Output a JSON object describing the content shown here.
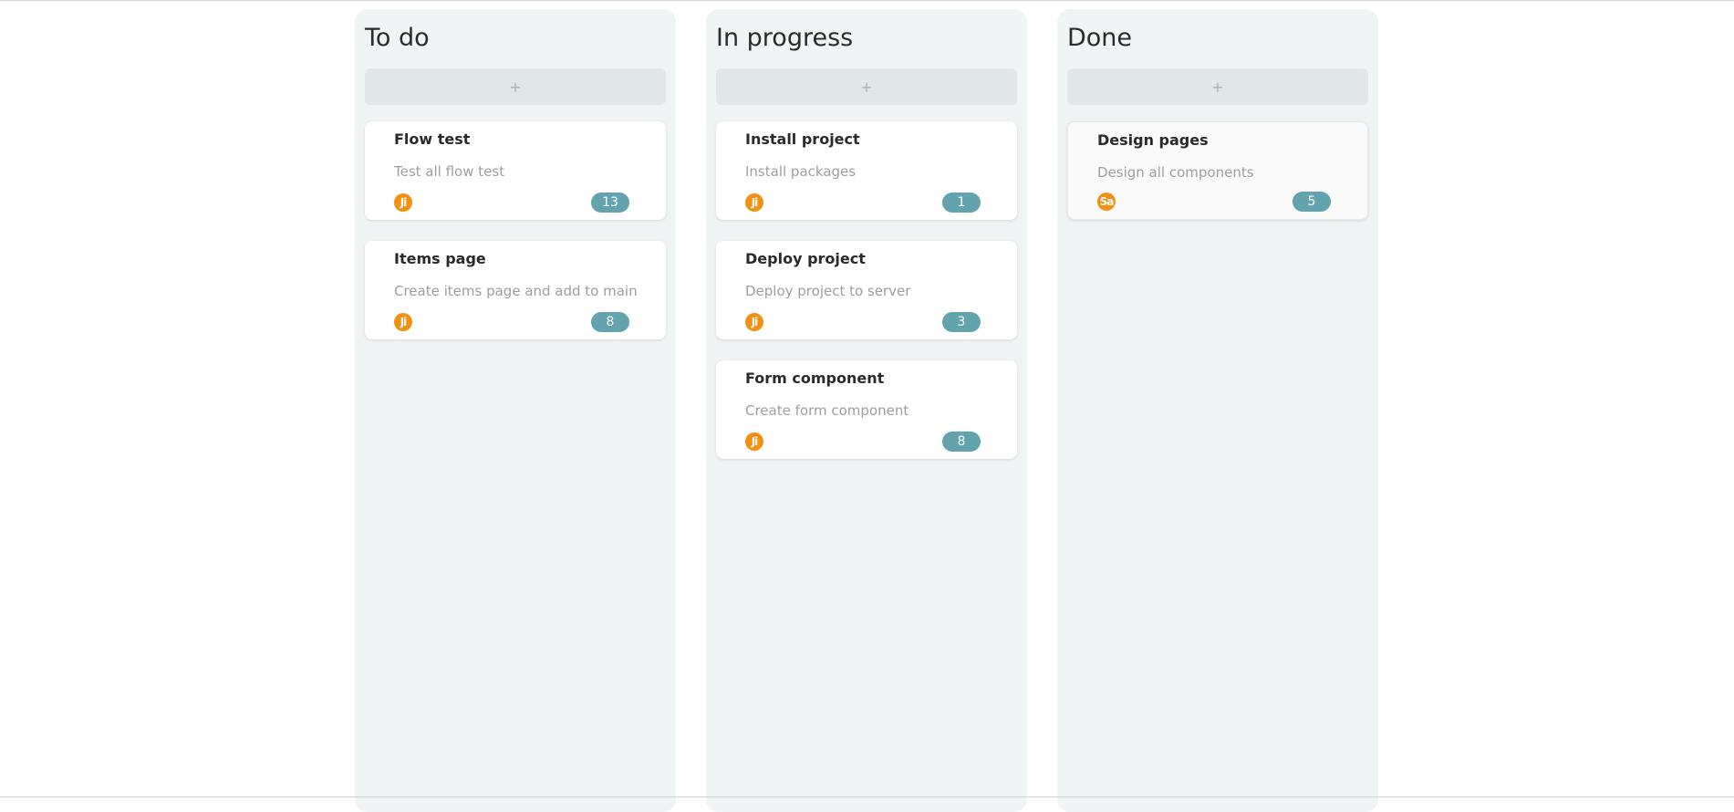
{
  "columns": [
    {
      "title": "To do",
      "add_label": "+",
      "cards": [
        {
          "title": "Flow test",
          "description": "Test all flow test",
          "avatar": "Ji",
          "points": "13"
        },
        {
          "title": "Items page",
          "description": "Create items page and add to main",
          "avatar": "Ji",
          "points": "8"
        }
      ]
    },
    {
      "title": "In progress",
      "add_label": "+",
      "cards": [
        {
          "title": "Install project",
          "description": "Install packages",
          "avatar": "Ji",
          "points": "1"
        },
        {
          "title": "Deploy project",
          "description": "Deploy project to server",
          "avatar": "Ji",
          "points": "3"
        },
        {
          "title": "Form component",
          "description": "Create form component",
          "avatar": "Ji",
          "points": "8"
        }
      ]
    },
    {
      "title": "Done",
      "add_label": "+",
      "cards": [
        {
          "title": "Design pages",
          "description": "Design all components",
          "avatar": "Sa",
          "points": "5"
        }
      ]
    }
  ],
  "colors": {
    "avatar": "#f29111",
    "points_badge": "#62a3ad",
    "column_bg": "#f1f4f5"
  }
}
